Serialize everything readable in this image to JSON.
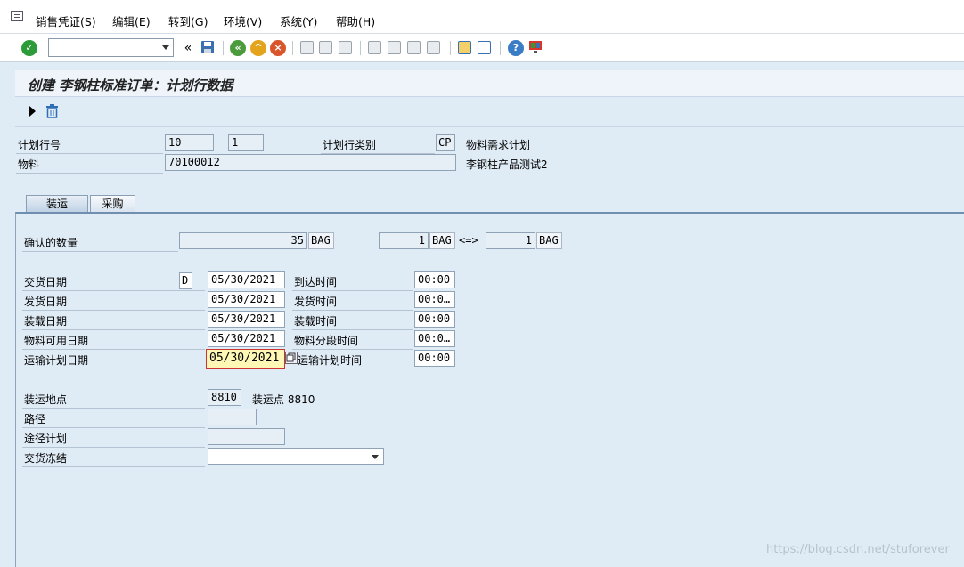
{
  "menu": {
    "items": [
      {
        "label": "销售凭证(S)"
      },
      {
        "label": "编辑(E)"
      },
      {
        "label": "转到(G)"
      },
      {
        "label": "环境(V)"
      },
      {
        "label": "系统(Y)"
      },
      {
        "label": "帮助(H)"
      }
    ]
  },
  "toolbar": {
    "command_value": "",
    "back_chevron": "«"
  },
  "title": "创建 李钢柱标准订单：计划行数据",
  "header": {
    "schedule_line_label": "计划行号",
    "item_no": "10",
    "schedule_line_no": "1",
    "schedule_line_cat_label": "计划行类别",
    "schedule_line_cat_value": "CP",
    "schedule_line_cat_desc": "物料需求计划",
    "material_label": "物料",
    "material_value": "70100012",
    "material_desc": "李钢柱产品测试2"
  },
  "tabs": [
    {
      "label": "装运",
      "active": true
    },
    {
      "label": "采购",
      "active": false
    }
  ],
  "shipping": {
    "confirmed_qty_label": "确认的数量",
    "confirmed_qty": "35",
    "confirmed_unit": "BAG",
    "ratio_left": "1",
    "ratio_left_unit": "BAG",
    "ratio_arrow": "<=>",
    "ratio_right": "1",
    "ratio_right_unit": "BAG",
    "dates": [
      {
        "label": "交货日期",
        "indicator": "D",
        "date": "05/30/2021",
        "time_label": "到达时间",
        "time": "00:00"
      },
      {
        "label": "发货日期",
        "indicator": "",
        "date": "05/30/2021",
        "time_label": "发货时间",
        "time": "00:0…"
      },
      {
        "label": "装载日期",
        "indicator": "",
        "date": "05/30/2021",
        "time_label": "装载时间",
        "time": "00:00"
      },
      {
        "label": "物料可用日期",
        "indicator": "",
        "date": "05/30/2021",
        "time_label": "物料分段时间",
        "time": "00:0…"
      },
      {
        "label": "运输计划日期",
        "indicator": "",
        "date": "05/30/2021",
        "time_label": "运输计划时间",
        "time": "00:00"
      }
    ],
    "shipping_point_label": "装运地点",
    "shipping_point": "8810",
    "shipping_point_desc": "装运点 8810",
    "route_label": "路径",
    "route": "",
    "route_schedule_label": "途径计划",
    "route_schedule": "",
    "delivery_block_label": "交货冻结",
    "delivery_block": ""
  },
  "watermark": "https://blog.csdn.net/stuforever",
  "colors": {
    "background": "#dfebf5",
    "highlight_field": "#fff7b5",
    "tab_border": "#6f8eb0"
  }
}
